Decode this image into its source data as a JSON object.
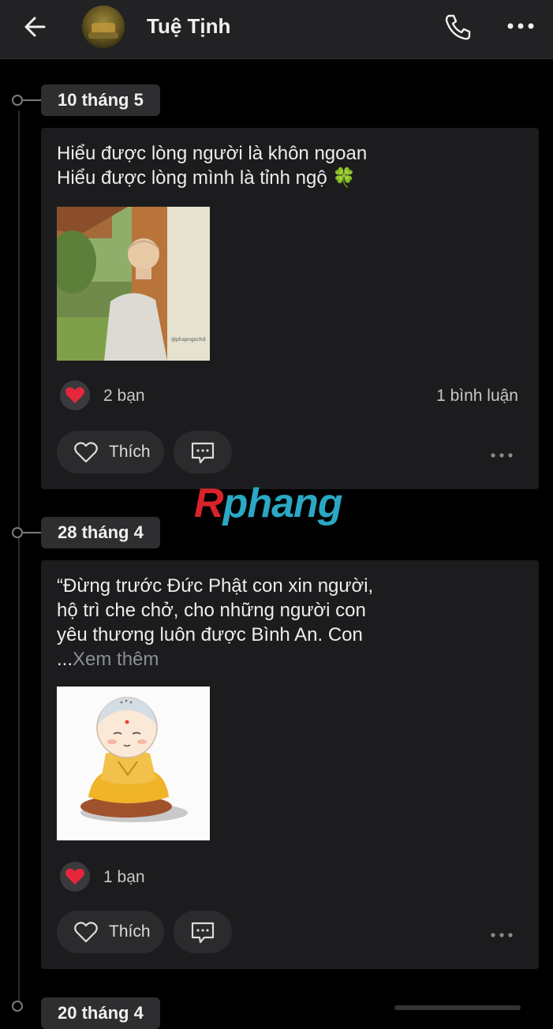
{
  "header": {
    "contact_name": "Tuệ Tịnh",
    "icons": [
      "back-arrow-icon",
      "phone-icon",
      "more-icon"
    ]
  },
  "timeline": [
    {
      "date": "10 tháng 5",
      "text_lines": [
        "Hiểu được lòng người là khôn ngoan",
        "Hiểu được lòng mình là tỉnh ngộ 🍀"
      ],
      "image_watermark": "@phapngochd",
      "reactions": "2 bạn",
      "comments": "1 bình luận",
      "like_label": "Thích"
    },
    {
      "date": "28 tháng 4",
      "text_lines": [
        "“Đừng trước Đức Phật con xin người,",
        "hộ trì che chở, cho những người con",
        "yêu thương luôn được Bình An. Con"
      ],
      "see_more_prefix": "...",
      "see_more_label": "Xem thêm",
      "reactions": "1 bạn",
      "like_label": "Thích"
    },
    {
      "date": "20 tháng 4"
    }
  ],
  "watermark": {
    "brand_r": "R",
    "brand_rest": "phang"
  },
  "colors": {
    "background": "#000000",
    "header": "#222224",
    "card": "#1c1c1e",
    "heart": "#e8263b",
    "brand_red": "#d8232a",
    "brand_teal": "#2aa8c4"
  }
}
